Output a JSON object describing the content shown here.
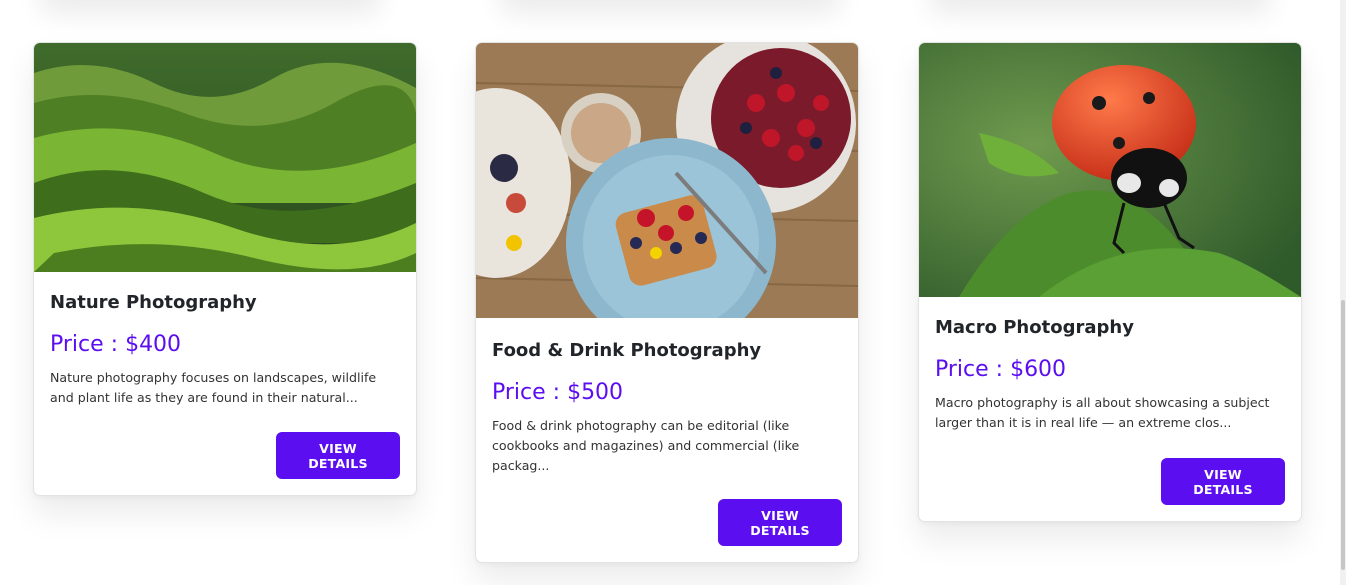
{
  "cards": [
    {
      "title": "Nature Photography",
      "price": "Price : $400",
      "description": "Nature photography focuses on landscapes, wildlife and plant life as they are found in their natural...",
      "button": "VIEW DETAILS",
      "image": "green-hills-photo"
    },
    {
      "title": "Food & Drink Photography",
      "price": "Price : $500",
      "description": "Food & drink photography can be editorial (like cookbooks and magazines) and commercial (like packag...",
      "button": "VIEW DETAILS",
      "image": "breakfast-table-photo"
    },
    {
      "title": "Macro Photography",
      "price": "Price : $600",
      "description": "Macro photography is all about showcasing a subject larger than it is in real life — an extreme clos...",
      "button": "VIEW DETAILS",
      "image": "ladybug-macro-photo"
    }
  ],
  "colors": {
    "accent": "#5b0ef0",
    "title": "#212529",
    "text": "#333333"
  }
}
